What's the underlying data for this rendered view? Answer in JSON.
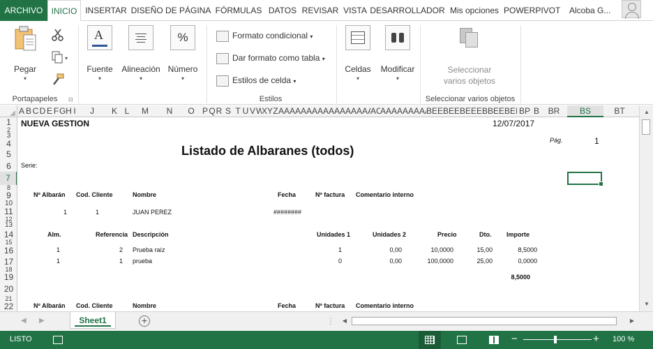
{
  "colors": {
    "excel_green": "#217346",
    "grid_header_bg": "#f3f3f3",
    "selection": "#217346"
  },
  "tabs": {
    "file": "ARCHIVO",
    "items": [
      "INICIO",
      "INSERTAR",
      "DISEÑO DE PÁGINA",
      "FÓRMULAS",
      "DATOS",
      "REVISAR",
      "VISTA",
      "DESARROLLADOR",
      "Mis opciones",
      "POWERPIVOT"
    ],
    "active": "INICIO",
    "user": "Alcoba G..."
  },
  "ribbon": {
    "clipboard": {
      "paste": "Pegar",
      "group": "Portapapeles",
      "cut_icon": "scissors-icon",
      "copy_icon": "copy-icon",
      "format_painter_icon": "paintbrush-icon"
    },
    "font": {
      "label": "Fuente",
      "icon": "font-color-icon"
    },
    "alignment": {
      "label": "Alineación",
      "icon": "align-icon"
    },
    "number": {
      "label": "Número",
      "icon_text": "%"
    },
    "styles": {
      "conditional_format": "Formato condicional",
      "format_as_table": "Dar formato como tabla",
      "cell_styles": "Estilos de celda",
      "group": "Estilos"
    },
    "cells": {
      "label": "Celdas"
    },
    "modify": {
      "label": "Modificar"
    },
    "select": {
      "label_line1": "Seleccionar",
      "label_line2": "varios objetos",
      "group": "Seleccionar varios objetos"
    }
  },
  "columns": {
    "visible": [
      "A",
      "B",
      "C",
      "D",
      "E",
      "F",
      "G",
      "H",
      "I",
      "J",
      "K",
      "L",
      "M",
      "N",
      "O",
      "P",
      "Q",
      "R",
      "S",
      "T",
      "U",
      "V",
      "W",
      "X",
      "Y",
      "Z",
      "AAAAAAAAAAAAAAAAAAAAAAAAAA",
      "AC",
      "AAAAAAAAAAAA",
      "BEEBEEBEEEBBEEBEEBC",
      "BP",
      "B",
      "BR",
      "BS",
      "BT"
    ],
    "selected": "BS"
  },
  "rows": {
    "numbers": [
      "1",
      "2",
      "3",
      "4",
      "5",
      "6",
      "7",
      "8",
      "9",
      "10",
      "11",
      "12",
      "13",
      "14",
      "15",
      "16",
      "17",
      "18",
      "19",
      "20",
      "21",
      "22"
    ],
    "selected": "7"
  },
  "report": {
    "company": "NUEVA GESTION",
    "date": "12/07/2017",
    "page_label": "Pág.",
    "page_value": "1",
    "title": "Listado de  Albaranes (todos)",
    "serie_label": "Serie:",
    "header1": {
      "albaran": "Nº Albarán",
      "cliente": "Cod. Cliente",
      "nombre": "Nombre",
      "fecha": "Fecha",
      "factura": "Nº factura",
      "comentario": "Comentario interno"
    },
    "record1": {
      "albaran": "1",
      "cliente": "1",
      "nombre": "JUAN PEREZ",
      "fecha": "########"
    },
    "lines_header": {
      "alm": "Alm.",
      "referencia": "Referencia",
      "descripcion": "Descripción",
      "unidades1": "Unidades 1",
      "unidades2": "Unidades 2",
      "precio": "Precio",
      "dto": "Dto.",
      "importe": "Importe"
    },
    "lines": [
      {
        "alm": "1",
        "referencia": "2",
        "descripcion": "Prueba raíz",
        "unidades1": "1",
        "unidades2": "0,00",
        "precio": "10,0000",
        "dto": "15,00",
        "importe": "8,5000"
      },
      {
        "alm": "1",
        "referencia": "1",
        "descripcion": "prueba",
        "unidades1": "0",
        "unidades2": "0,00",
        "precio": "100,0000",
        "dto": "25,00",
        "importe": "0,0000"
      }
    ],
    "total": "8,5000",
    "header2": {
      "albaran": "Nº Albarán",
      "cliente": "Cod. Cliente",
      "nombre": "Nombre",
      "fecha": "Fecha",
      "factura": "Nº factura",
      "comentario": "Comentario interno"
    }
  },
  "sheets": {
    "items": [
      "Sheet1"
    ],
    "active": "Sheet1",
    "add_icon": "plus-circle-icon"
  },
  "status": {
    "text": "LISTO",
    "zoom": "100 %",
    "zoom_fraction": 0.5
  }
}
